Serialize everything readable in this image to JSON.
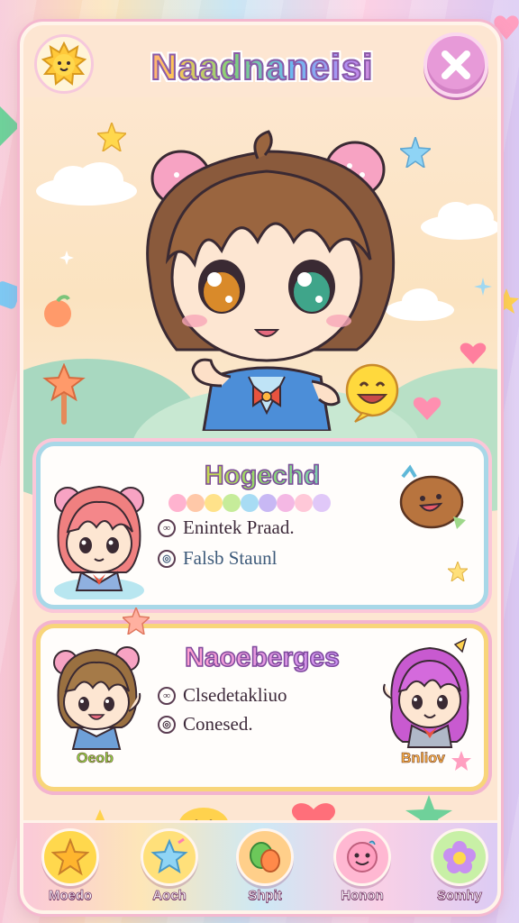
{
  "header": {
    "title": "Naadnaneisi",
    "sun_icon": "sun-mascot-icon",
    "close_icon": "close-icon"
  },
  "hero": {
    "character": "chibi-boy-with-bear-ears",
    "emoji": "laughing-emoji"
  },
  "card_top": {
    "title": "Hogechd",
    "row1_text": "Enintek Praad.",
    "row2_text": "Falsb Staunl",
    "mascot": "brown-cookie-mascot"
  },
  "card_bottom": {
    "title": "Naoeberges",
    "row1_text": "Clsedetakliuo",
    "row2_text": "Conesed.",
    "left_badge": "Oeob",
    "right_badge": "Bnliov"
  },
  "nav": {
    "items": [
      {
        "label": "Moedo",
        "icon": "star-icon",
        "color": "#ffd84d"
      },
      {
        "label": "Aoch",
        "icon": "sparkle-star-icon",
        "color": "#ffe07a"
      },
      {
        "label": "Shpit",
        "icon": "leaf-icon",
        "color": "#ffcf8a"
      },
      {
        "label": "Honon",
        "icon": "smiley-icon",
        "color": "#ffb8d2"
      },
      {
        "label": "Somhy",
        "icon": "flower-icon",
        "color": "#c8f0a6"
      }
    ]
  },
  "colors": {
    "frame": "#fde6d2",
    "accent_pink": "#e79ad8",
    "card_top_border": "#a8d8e8",
    "card_bottom_border": "#f8d57a"
  }
}
